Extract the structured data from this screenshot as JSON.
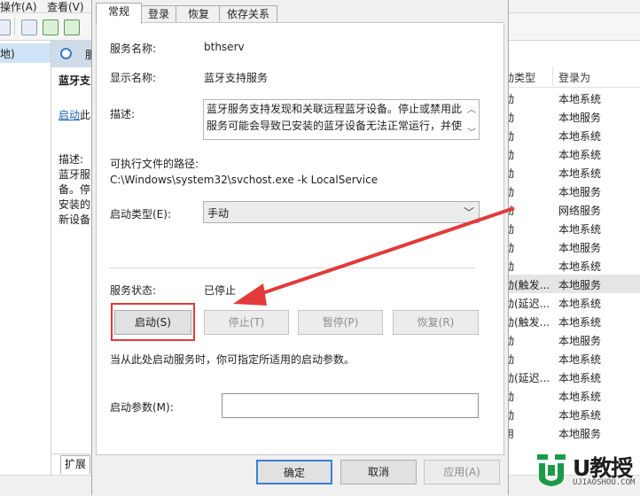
{
  "background_window": {
    "menu": [
      "操作(A)",
      "查看(V)"
    ],
    "left_pane_item": "地)",
    "mid_pane": {
      "header_fragment": "服",
      "title_fragment": "蓝牙支",
      "link_fragment": "启动",
      "link_suffix": "此",
      "desc_label": "描述:",
      "desc_lines": [
        "蓝牙服",
        "备。停",
        "安装的",
        "新设备"
      ]
    },
    "columns": {
      "startup_type_fragment": "动类型",
      "logon_as": "登录为"
    },
    "rows": [
      {
        "a": "动",
        "b": "本地系统"
      },
      {
        "a": "动",
        "b": "本地服务"
      },
      {
        "a": "动",
        "b": "本地系统"
      },
      {
        "a": "动",
        "b": "本地系统"
      },
      {
        "a": "动",
        "b": "本地系统"
      },
      {
        "a": "动",
        "b": "本地服务"
      },
      {
        "a": "动",
        "b": "网络服务"
      },
      {
        "a": "动",
        "b": "本地系统"
      },
      {
        "a": "动",
        "b": "本地服务"
      },
      {
        "a": "动",
        "b": "本地系统"
      },
      {
        "a": "动(触发...",
        "b": "本地服务",
        "highlight": true
      },
      {
        "a": "动(延迟...",
        "b": "本地系统"
      },
      {
        "a": "动(触发...",
        "b": "本地系统"
      },
      {
        "a": "动",
        "b": "本地服务"
      },
      {
        "a": "动",
        "b": "本地系统"
      },
      {
        "a": "动(延迟...",
        "b": "本地系统"
      },
      {
        "a": "动",
        "b": "本地系统"
      },
      {
        "a": "动",
        "b": "本地系统"
      },
      {
        "a": "用",
        "b": "本地服务"
      }
    ],
    "bottom_tab": "扩展"
  },
  "dialog": {
    "tabs": [
      "常规",
      "登录",
      "恢复",
      "依存关系"
    ],
    "active_tab": 0,
    "service_name_label": "服务名称:",
    "service_name": "bthserv",
    "display_name_label": "显示名称:",
    "display_name": "蓝牙支持服务",
    "description_label": "描述:",
    "description": "蓝牙服务支持发现和关联远程蓝牙设备。停止或禁用此\n服务可能会导致已安装的蓝牙设备无法正常运行，并使",
    "exe_path_label": "可执行文件的路径:",
    "exe_path": "C:\\Windows\\system32\\svchost.exe -k LocalService",
    "startup_type_label": "启动类型(E):",
    "startup_type": "手动",
    "status_label": "服务状态:",
    "status": "已停止",
    "buttons": {
      "start": "启动(S)",
      "stop": "停止(T)",
      "pause": "暂停(P)",
      "resume": "恢复(R)"
    },
    "hint": "当从此处启动服务时，你可指定所适用的启动参数。",
    "start_params_label": "启动参数(M):",
    "start_params_value": "",
    "footer": {
      "ok": "确定",
      "cancel": "取消",
      "apply": "应用(A)"
    }
  },
  "annotation": {
    "highlight_color": "#e23a3a",
    "arrow_color": "#e23a3a"
  },
  "watermark": {
    "brand": "U教授",
    "url": "UJIAOSHOU.COM",
    "color": "#1a9a4a"
  }
}
